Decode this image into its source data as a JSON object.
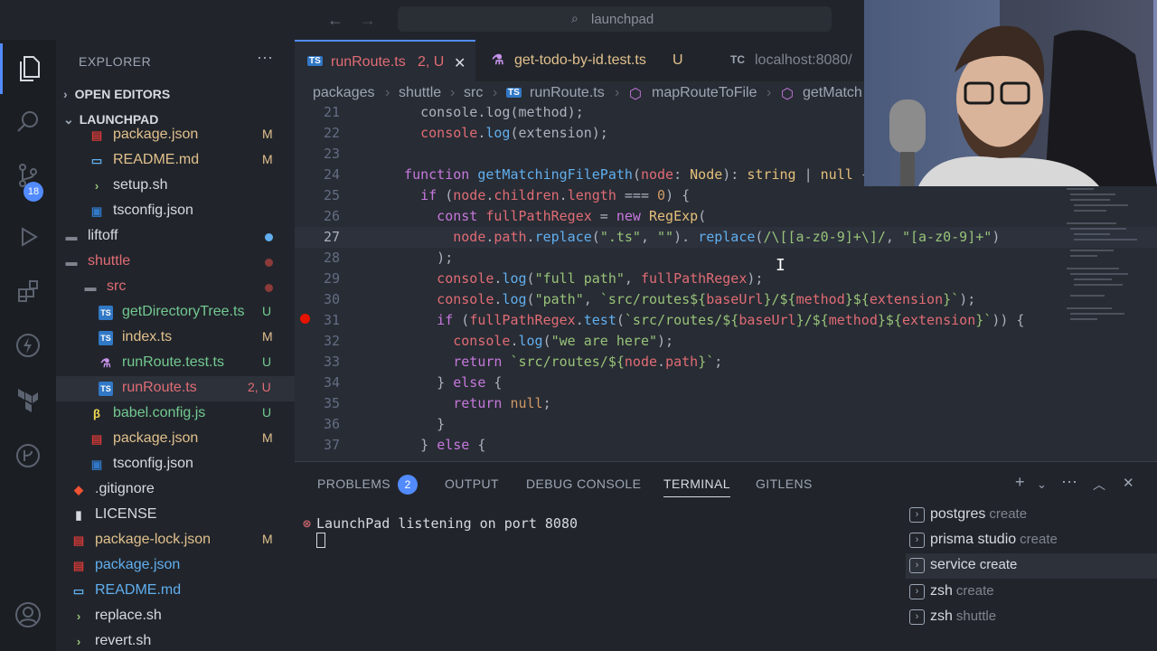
{
  "titlebar": {
    "search_text": "launchpad"
  },
  "activity": {
    "source_control_count": "18"
  },
  "explorer": {
    "title": "EXPLORER",
    "open_editors": "OPEN EDITORS",
    "project": "LAUNCHPAD",
    "items": [
      {
        "label": "package.json",
        "status": "M",
        "kind": "json"
      },
      {
        "label": "README.md",
        "status": "M",
        "kind": "md"
      },
      {
        "label": "setup.sh",
        "status": "",
        "kind": "sh"
      },
      {
        "label": "tsconfig.json",
        "status": "",
        "kind": "tsconfig"
      },
      {
        "label": "liftoff",
        "status": "",
        "kind": "folder"
      },
      {
        "label": "shuttle",
        "status": "",
        "kind": "folder"
      },
      {
        "label": "src",
        "status": "",
        "kind": "folder"
      },
      {
        "label": "getDirectoryTree.ts",
        "status": "U",
        "kind": "ts"
      },
      {
        "label": "index.ts",
        "status": "M",
        "kind": "ts"
      },
      {
        "label": "runRoute.test.ts",
        "status": "U",
        "kind": "test"
      },
      {
        "label": "runRoute.ts",
        "status": "2, U",
        "kind": "ts"
      },
      {
        "label": "babel.config.js",
        "status": "U",
        "kind": "babel"
      },
      {
        "label": "package.json",
        "status": "M",
        "kind": "json"
      },
      {
        "label": "tsconfig.json",
        "status": "",
        "kind": "tsconfig"
      },
      {
        "label": ".gitignore",
        "status": "",
        "kind": "git"
      },
      {
        "label": "LICENSE",
        "status": "",
        "kind": "license"
      },
      {
        "label": "package-lock.json",
        "status": "M",
        "kind": "json"
      },
      {
        "label": "package.json",
        "status": "",
        "kind": "json"
      },
      {
        "label": "README.md",
        "status": "",
        "kind": "md"
      },
      {
        "label": "replace.sh",
        "status": "",
        "kind": "sh"
      },
      {
        "label": "revert.sh",
        "status": "",
        "kind": "sh"
      }
    ]
  },
  "tabs": [
    {
      "icon": "TS",
      "label": "runRoute.ts",
      "status": "2, U"
    },
    {
      "icon": "",
      "label": "get-todo-by-id.test.ts",
      "status": "U"
    },
    {
      "icon": "TC",
      "label": "localhost:8080/",
      "status": ""
    }
  ],
  "breadcrumbs": {
    "parts": [
      "packages",
      "shuttle",
      "src",
      "runRoute.ts",
      "mapRouteToFile",
      "getMatch"
    ],
    "ts_icon": "TS"
  },
  "editor": {
    "lines": [
      {
        "n": "21",
        "tokens": [
          [
            "pl",
            "    console.log(method);"
          ]
        ]
      },
      {
        "n": "22",
        "tokens": [
          [
            "var",
            "    console"
          ],
          [
            "pl",
            "."
          ],
          [
            "fn",
            "log"
          ],
          [
            "pl",
            "(extension);"
          ]
        ]
      },
      {
        "n": "23",
        "tokens": [
          [
            "pl",
            ""
          ]
        ]
      },
      {
        "n": "24",
        "tokens": [
          [
            "kw",
            "  function "
          ],
          [
            "fn",
            "getMatchingFilePath"
          ],
          [
            "pl",
            "("
          ],
          [
            "var",
            "node"
          ],
          [
            "pl",
            ": "
          ],
          [
            "typ",
            "Node"
          ],
          [
            "pl",
            "): "
          ],
          [
            "typ",
            "string"
          ],
          [
            "pl",
            " | "
          ],
          [
            "typ",
            "null"
          ],
          [
            "pl",
            " {"
          ]
        ]
      },
      {
        "n": "25",
        "tokens": [
          [
            "kw",
            "    if "
          ],
          [
            "pl",
            "("
          ],
          [
            "var",
            "node"
          ],
          [
            "pl",
            "."
          ],
          [
            "var",
            "children"
          ],
          [
            "pl",
            "."
          ],
          [
            "var",
            "length"
          ],
          [
            "pl",
            " === "
          ],
          [
            "num",
            "0"
          ],
          [
            "pl",
            ") {"
          ]
        ]
      },
      {
        "n": "26",
        "tokens": [
          [
            "kw",
            "      const "
          ],
          [
            "var",
            "fullPathRegex"
          ],
          [
            "pl",
            " = "
          ],
          [
            "kw",
            "new "
          ],
          [
            "typ",
            "RegExp"
          ],
          [
            "pl",
            "("
          ]
        ]
      },
      {
        "n": "27",
        "tokens": [
          [
            "var",
            "        node"
          ],
          [
            "pl",
            "."
          ],
          [
            "var",
            "path"
          ],
          [
            "pl",
            "."
          ],
          [
            "fn",
            "replace"
          ],
          [
            "pl",
            "("
          ],
          [
            "str",
            "\".ts\""
          ],
          [
            "pl",
            ", "
          ],
          [
            "str",
            "\"\""
          ],
          [
            "pl",
            "). "
          ],
          [
            "fn",
            "replace"
          ],
          [
            "pl",
            "("
          ],
          [
            "str",
            "/\\[[a-z0-9]+\\]/"
          ],
          [
            "pl",
            ", "
          ],
          [
            "str",
            "\"[a-z0-9]+\""
          ],
          [
            "pl",
            ")"
          ]
        ]
      },
      {
        "n": "28",
        "tokens": [
          [
            "pl",
            "      );"
          ]
        ]
      },
      {
        "n": "29",
        "tokens": [
          [
            "var",
            "      console"
          ],
          [
            "pl",
            "."
          ],
          [
            "fn",
            "log"
          ],
          [
            "pl",
            "("
          ],
          [
            "str",
            "\"full path\""
          ],
          [
            "pl",
            ", "
          ],
          [
            "var",
            "fullPathRegex"
          ],
          [
            "pl",
            ");"
          ]
        ]
      },
      {
        "n": "30",
        "tokens": [
          [
            "var",
            "      console"
          ],
          [
            "pl",
            "."
          ],
          [
            "fn",
            "log"
          ],
          [
            "pl",
            "("
          ],
          [
            "str",
            "\"path\""
          ],
          [
            "pl",
            ", "
          ],
          [
            "str",
            "`src/routes${"
          ],
          [
            "var",
            "baseUrl"
          ],
          [
            "str",
            "}/${"
          ],
          [
            "var",
            "method"
          ],
          [
            "str",
            "}${"
          ],
          [
            "var",
            "extension"
          ],
          [
            "str",
            "}`"
          ],
          [
            "pl",
            ");"
          ]
        ]
      },
      {
        "n": "31",
        "tokens": [
          [
            "kw",
            "      if "
          ],
          [
            "pl",
            "("
          ],
          [
            "var",
            "fullPathRegex"
          ],
          [
            "pl",
            "."
          ],
          [
            "fn",
            "test"
          ],
          [
            "pl",
            "("
          ],
          [
            "str",
            "`src/routes/${"
          ],
          [
            "var",
            "baseUrl"
          ],
          [
            "str",
            "}/${"
          ],
          [
            "var",
            "method"
          ],
          [
            "str",
            "}${"
          ],
          [
            "var",
            "extension"
          ],
          [
            "str",
            "}`"
          ],
          [
            "pl",
            ")) {"
          ]
        ]
      },
      {
        "n": "32",
        "tokens": [
          [
            "var",
            "        console"
          ],
          [
            "pl",
            "."
          ],
          [
            "fn",
            "log"
          ],
          [
            "pl",
            "("
          ],
          [
            "str",
            "\"we are here\""
          ],
          [
            "pl",
            ");"
          ]
        ]
      },
      {
        "n": "33",
        "tokens": [
          [
            "kw",
            "        return "
          ],
          [
            "str",
            "`src/routes/${"
          ],
          [
            "var",
            "node"
          ],
          [
            "pl",
            "."
          ],
          [
            "var",
            "path"
          ],
          [
            "str",
            "}`"
          ],
          [
            "pl",
            ";"
          ]
        ]
      },
      {
        "n": "34",
        "tokens": [
          [
            "pl",
            "      } "
          ],
          [
            "kw",
            "else"
          ],
          [
            "pl",
            " {"
          ]
        ]
      },
      {
        "n": "35",
        "tokens": [
          [
            "kw",
            "        return "
          ],
          [
            "num",
            "null"
          ],
          [
            "pl",
            ";"
          ]
        ]
      },
      {
        "n": "36",
        "tokens": [
          [
            "pl",
            "      }"
          ]
        ]
      },
      {
        "n": "37",
        "tokens": [
          [
            "pl",
            "    } "
          ],
          [
            "kw",
            "else"
          ],
          [
            "pl",
            " {"
          ]
        ]
      }
    ]
  },
  "panel": {
    "tabs": [
      "PROBLEMS",
      "OUTPUT",
      "DEBUG CONSOLE",
      "TERMINAL",
      "GITLENS"
    ],
    "problems_count": "2",
    "terminal_output": "LaunchPad listening on port 8080",
    "terminals": [
      {
        "name": "postgres",
        "sub": "create"
      },
      {
        "name": "prisma studio",
        "sub": "create"
      },
      {
        "name": "service",
        "sub": "create"
      },
      {
        "name": "zsh",
        "sub": "create"
      },
      {
        "name": "zsh",
        "sub": "shuttle"
      }
    ]
  },
  "colors": {
    "accent": "#528bff",
    "error": "#e51400",
    "modified": "#e2c08d",
    "untracked": "#73c991",
    "conflict": "#e06c75"
  }
}
